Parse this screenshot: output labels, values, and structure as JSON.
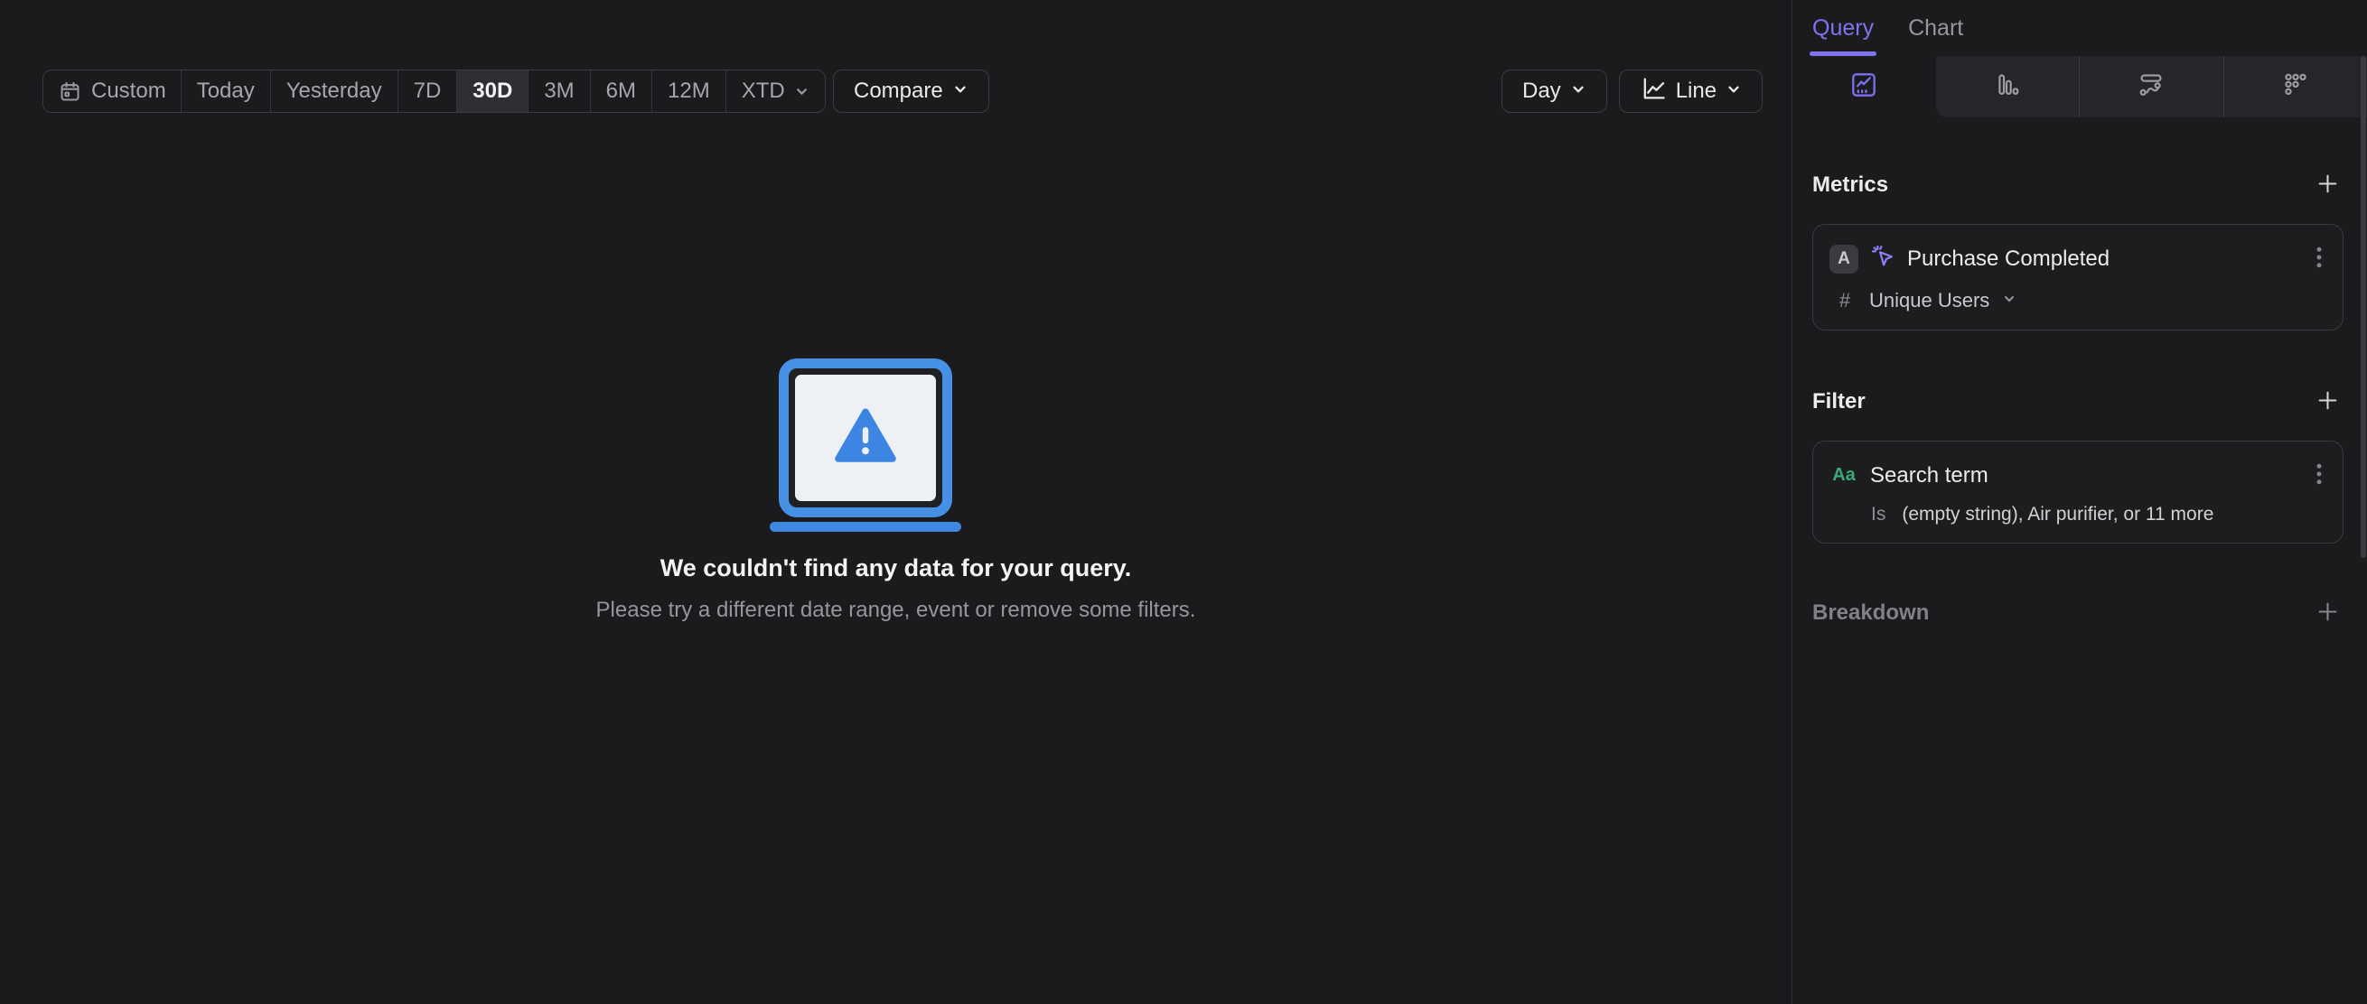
{
  "toolbar": {
    "date_ranges": [
      {
        "label": "Custom",
        "selected": false,
        "icon": "calendar"
      },
      {
        "label": "Today",
        "selected": false
      },
      {
        "label": "Yesterday",
        "selected": false
      },
      {
        "label": "7D",
        "selected": false
      },
      {
        "label": "30D",
        "selected": true
      },
      {
        "label": "3M",
        "selected": false
      },
      {
        "label": "6M",
        "selected": false
      },
      {
        "label": "12M",
        "selected": false
      },
      {
        "label": "XTD",
        "selected": false,
        "has_chevron": true
      }
    ],
    "compare_label": "Compare",
    "granularity_label": "Day",
    "chart_type_label": "Line"
  },
  "empty_state": {
    "title": "We couldn't find any data for your query.",
    "subtitle": "Please try a different date range, event or remove some filters."
  },
  "sidebar": {
    "tabs": [
      {
        "label": "Query",
        "active": true
      },
      {
        "label": "Chart",
        "active": false
      }
    ],
    "view_tabs": [
      {
        "icon": "insights-line-chart-icon",
        "active": true
      },
      {
        "icon": "bar-chart-icon",
        "active": false
      },
      {
        "icon": "flow-icon",
        "active": false
      },
      {
        "icon": "metrics-grid-icon",
        "active": false
      }
    ],
    "metrics": {
      "header": "Metrics",
      "items": [
        {
          "series_letter": "A",
          "event_name": "Purchase Completed",
          "aggregation_prefix": "#",
          "aggregation": "Unique Users"
        }
      ]
    },
    "filter": {
      "header": "Filter",
      "items": [
        {
          "property_type_label": "Aa",
          "property": "Search term",
          "operator": "Is",
          "value": "(empty string), Air purifier, or 11 more"
        }
      ]
    },
    "breakdown": {
      "header": "Breakdown"
    }
  },
  "colors": {
    "background": "#1b1b1d",
    "accent_purple": "#7e73f1",
    "empty_state_blue": "#4690e5",
    "string_property_green": "#3da878",
    "selected_segment_bg": "#2e2e33"
  }
}
